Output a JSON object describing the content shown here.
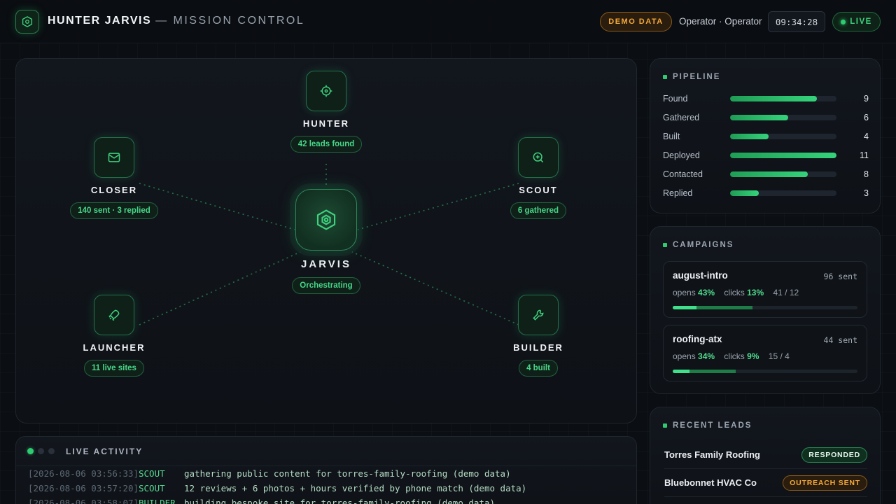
{
  "header": {
    "title": "HUNTER JARVIS",
    "subtitle": "— MISSION CONTROL",
    "demo_badge": "DEMO DATA",
    "operator": "Operator · Operator",
    "clock": "09:34:28",
    "live": "LIVE"
  },
  "network": {
    "core": {
      "label": "JARVIS",
      "status": "Orchestrating",
      "icon": "hexagon-gear-icon"
    },
    "nodes": {
      "hunter": {
        "label": "HUNTER",
        "stat": "42 leads found",
        "icon": "crosshair-icon"
      },
      "scout": {
        "label": "SCOUT",
        "stat": "6 gathered",
        "icon": "magnifier-plus-icon"
      },
      "closer": {
        "label": "CLOSER",
        "stat": "140 sent · 3 replied",
        "icon": "mail-icon"
      },
      "launcher": {
        "label": "LAUNCHER",
        "stat": "11 live sites",
        "icon": "rocket-icon"
      },
      "builder": {
        "label": "BUILDER",
        "stat": "4 built",
        "icon": "wrench-icon"
      }
    }
  },
  "activity": {
    "title": "LIVE ACTIVITY",
    "lines": [
      {
        "ts": "[2026-08-06 03:56:33]",
        "agent": "SCOUT",
        "msg": "gathering public content for torres-family-roofing (demo data)"
      },
      {
        "ts": "[2026-08-06 03:57:20]",
        "agent": "SCOUT",
        "msg": "12 reviews + 6 photos + hours verified by phone match (demo data)"
      },
      {
        "ts": "[2026-08-06 03:58:07]",
        "agent": "BUILDER",
        "msg": "building bespoke site for torres-family-roofing (demo data)"
      }
    ]
  },
  "pipeline": {
    "title": "PIPELINE",
    "max": 11,
    "rows": [
      {
        "label": "Found",
        "value": 9
      },
      {
        "label": "Gathered",
        "value": 6
      },
      {
        "label": "Built",
        "value": 4
      },
      {
        "label": "Deployed",
        "value": 11
      },
      {
        "label": "Contacted",
        "value": 8
      },
      {
        "label": "Replied",
        "value": 3
      }
    ]
  },
  "campaigns": {
    "title": "CAMPAIGNS",
    "items": [
      {
        "name": "august-intro",
        "sent": "96 sent",
        "opens_label": "opens",
        "opens": "43%",
        "clicks_label": "clicks",
        "clicks": "13%",
        "ratio": "41 / 12",
        "open_frac": 0.43,
        "click_frac": 0.13
      },
      {
        "name": "roofing-atx",
        "sent": "44 sent",
        "opens_label": "opens",
        "opens": "34%",
        "clicks_label": "clicks",
        "clicks": "9%",
        "ratio": "15 / 4",
        "open_frac": 0.34,
        "click_frac": 0.09
      }
    ]
  },
  "leads": {
    "title": "RECENT LEADS",
    "items": [
      {
        "name": "Torres Family Roofing",
        "status": "RESPONDED"
      },
      {
        "name": "Bluebonnet HVAC Co",
        "status": "OUTREACH SENT"
      }
    ]
  },
  "colors": {
    "accent": "#2ecc71",
    "warning": "#f5a93b",
    "background": "#0b0e13"
  }
}
